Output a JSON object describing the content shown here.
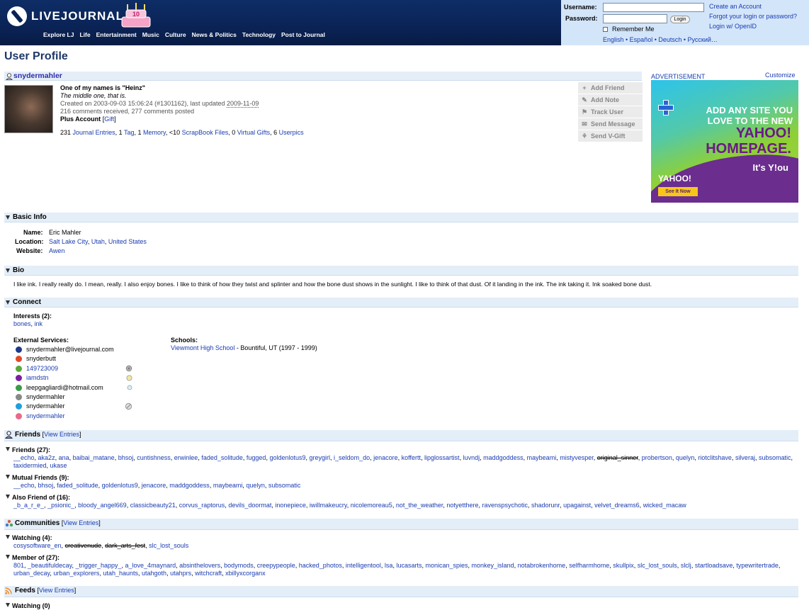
{
  "header": {
    "logo_text": "LIVEJOURNAL",
    "nav": [
      "Explore LJ",
      "Life",
      "Entertainment",
      "Music",
      "Culture",
      "News & Politics",
      "Technology",
      "Post to Journal"
    ]
  },
  "login": {
    "username_label": "Username:",
    "password_label": "Password:",
    "username_value": "",
    "password_value": "",
    "login_button": "Login",
    "remember_me": "Remember Me",
    "create_account": "Create an Account",
    "forgot": "Forgot your login or password?",
    "openid": "Login w/ OpenID",
    "languages": "English • Español • Deutsch • Русский…"
  },
  "page": {
    "title": "User Profile"
  },
  "profile": {
    "username": "snydermahler",
    "name_line": "One of my names is \"Heinz\"",
    "subtitle": "The middle one, that is.",
    "created_prefix": "Created on 2003-09-03 15:06:24 (#1301162), last updated ",
    "updated": "2009-11-09",
    "comments": "216 comments received, 277 comments posted",
    "account_type": "Plus Account",
    "gift": "Gift",
    "stats": [
      {
        "num": "231",
        "label": "Journal Entries"
      },
      {
        "num": "1",
        "label": "Tag"
      },
      {
        "num": "1",
        "label": "Memory"
      },
      {
        "num": "<10",
        "label": "ScrapBook Files"
      },
      {
        "num": "0",
        "label": "Virtual Gifts"
      },
      {
        "num": "6",
        "label": "Userpics"
      }
    ]
  },
  "actions": [
    "Add Friend",
    "Add Note",
    "Track User",
    "Send Message",
    "Send V-Gift"
  ],
  "ad": {
    "label": "ADVERTISEMENT",
    "customize": "Customize",
    "line1": "ADD ANY SITE YOU",
    "line2": "LOVE TO THE NEW",
    "line3": "YAHOO!",
    "line4": "HOMEPAGE.",
    "brand": "YAHOO!",
    "tagline": "It's Y!ou",
    "cta": "See It Now"
  },
  "basic_info": {
    "title": "Basic Info",
    "name_label": "Name:",
    "name_value": "Eric Mahler",
    "location_label": "Location:",
    "location": [
      "Salt Lake City",
      "Utah",
      "United States"
    ],
    "website_label": "Website:",
    "website": "Awen"
  },
  "bio": {
    "title": "Bio",
    "text": "I like ink. I really really do. I mean, really. I also enjoy bones. I like to think of how they twist and splinter and how the bone dust shows in the sunlight. I like to think of that dust. Of it landing in the ink. The ink taking it. Ink soaked bone dust."
  },
  "connect": {
    "title": "Connect",
    "interests_label": "Interests (2):",
    "interests": [
      "bones",
      "ink"
    ],
    "external_label": "External Services:",
    "services": [
      {
        "value": "snydermahler@livejournal.com",
        "link": false,
        "icon": "livejournal-pen-icon",
        "color": "#1d3a8a"
      },
      {
        "value": "snyderbutt",
        "link": false,
        "icon": "aim-icon",
        "color": "#e04a2a"
      },
      {
        "value": "149723009",
        "link": true,
        "icon": "icq-flower-icon",
        "color": "#5aa83a"
      },
      {
        "value": "iamdstn",
        "link": true,
        "icon": "yahoo-messenger-icon",
        "color": "#7b1fa2"
      },
      {
        "value": "leepgagliardi@hotmail.com",
        "link": false,
        "icon": "msn-messenger-icon",
        "color": "#3c9a4a"
      },
      {
        "value": "snydermahler",
        "link": false,
        "icon": "jabber-icon",
        "color": "#888888"
      },
      {
        "value": "snydermahler",
        "link": false,
        "icon": "skype-icon",
        "color": "#1ea0dc"
      },
      {
        "value": "snydermahler",
        "link": true,
        "icon": "google-talk-icon",
        "color": "#e86a8a"
      }
    ],
    "schools_label": "Schools:",
    "school": "Viewmont High School",
    "school_detail": " - Bountiful, UT (1997 - 1999)"
  },
  "friends": {
    "title": "Friends",
    "view_entries": "View Entries",
    "friends_label": "Friends (27):",
    "friends": [
      "__echo",
      "aka2z",
      "ana",
      "baibai_matane",
      "bhsoj",
      "cuntishness",
      "erwinlee",
      "faded_solitude",
      "fugged",
      "goldenlotus9",
      "greygirl",
      "i_seldom_do",
      "jenacore",
      "koffertt",
      "lipglossartist",
      "luvndj",
      "maddgoddess",
      "maybeami",
      "mistyvesper",
      "original_sinner",
      "probertson",
      "quelyn",
      "riotclitshave",
      "silveraj",
      "subsomatic",
      "taxidermied",
      "ukase"
    ],
    "mutual_label": "Mutual Friends (9):",
    "mutual": [
      "__echo",
      "bhsoj",
      "faded_solitude",
      "goldenlotus9",
      "jenacore",
      "maddgoddess",
      "maybeami",
      "quelyn",
      "subsomatic"
    ],
    "also_label": "Also Friend of (16):",
    "also": [
      "_b_a_r_e_",
      "_psionic_",
      "bloody_angel669",
      "classicbeauty21",
      "corvus_raptorus",
      "devils_doormat",
      "inonepiece",
      "iwillmakeucry",
      "nicolemoreau5",
      "not_the_weather",
      "notyetthere",
      "ravenspsychotic",
      "shadorunr",
      "upagainst",
      "velvet_dreams6",
      "wicked_macaw"
    ]
  },
  "communities": {
    "title": "Communities",
    "view_entries": "View Entries",
    "watching_label": "Watching (4):",
    "watching": [
      "cosysoftware_en",
      "creativenude",
      "dark_arts_fest",
      "slc_lost_souls"
    ],
    "member_label": "Member of (27):",
    "member": [
      "801",
      "_beautifuldecay",
      "_trigger_happy_",
      "a_love_4maynard",
      "absinthelovers",
      "bodymods",
      "creepypeople",
      "hacked_photos",
      "intelligentool",
      "lsa",
      "lucasarts",
      "monican_spies",
      "monkey_island",
      "notabrokenhome",
      "selfharmhome",
      "skullpix",
      "slc_lost_souls",
      "slclj",
      "startloadsave",
      "typewritertrade",
      "urban_decay",
      "urban_explorers",
      "utah_haunts",
      "utahgoth",
      "utahprs",
      "witchcraft",
      "xbillyxcorganx"
    ]
  },
  "feeds": {
    "title": "Feeds",
    "view_entries": "View Entries",
    "watching_label": "Watching (0)"
  }
}
